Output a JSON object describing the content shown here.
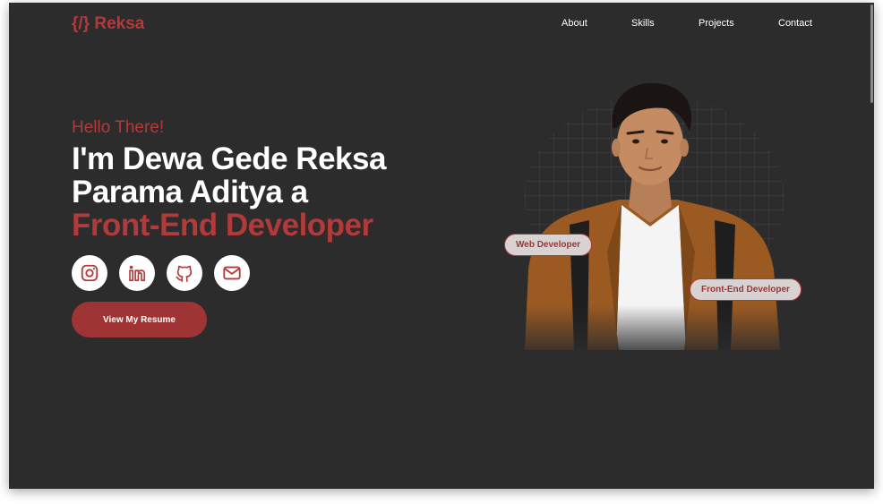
{
  "logo": {
    "text": "{/} Reksa"
  },
  "nav": {
    "items": [
      {
        "label": "About"
      },
      {
        "label": "Skills"
      },
      {
        "label": "Projects"
      },
      {
        "label": "Contact"
      }
    ]
  },
  "hero": {
    "greeting": "Hello There!",
    "line1": "I'm Dewa Gede Reksa",
    "line2": "Parama Aditya a",
    "line3": "Front-End Developer",
    "resume_button": "View My Resume"
  },
  "social": [
    {
      "icon": "instagram-icon"
    },
    {
      "icon": "linkedin-icon"
    },
    {
      "icon": "github-icon"
    },
    {
      "icon": "mail-icon"
    }
  ],
  "tags": {
    "web": "Web Developer",
    "frontend": "Front-End Developer"
  },
  "colors": {
    "background": "#2c2c2c",
    "accent": "#b23a3a",
    "button": "#9f3434",
    "text": "#ffffff"
  }
}
